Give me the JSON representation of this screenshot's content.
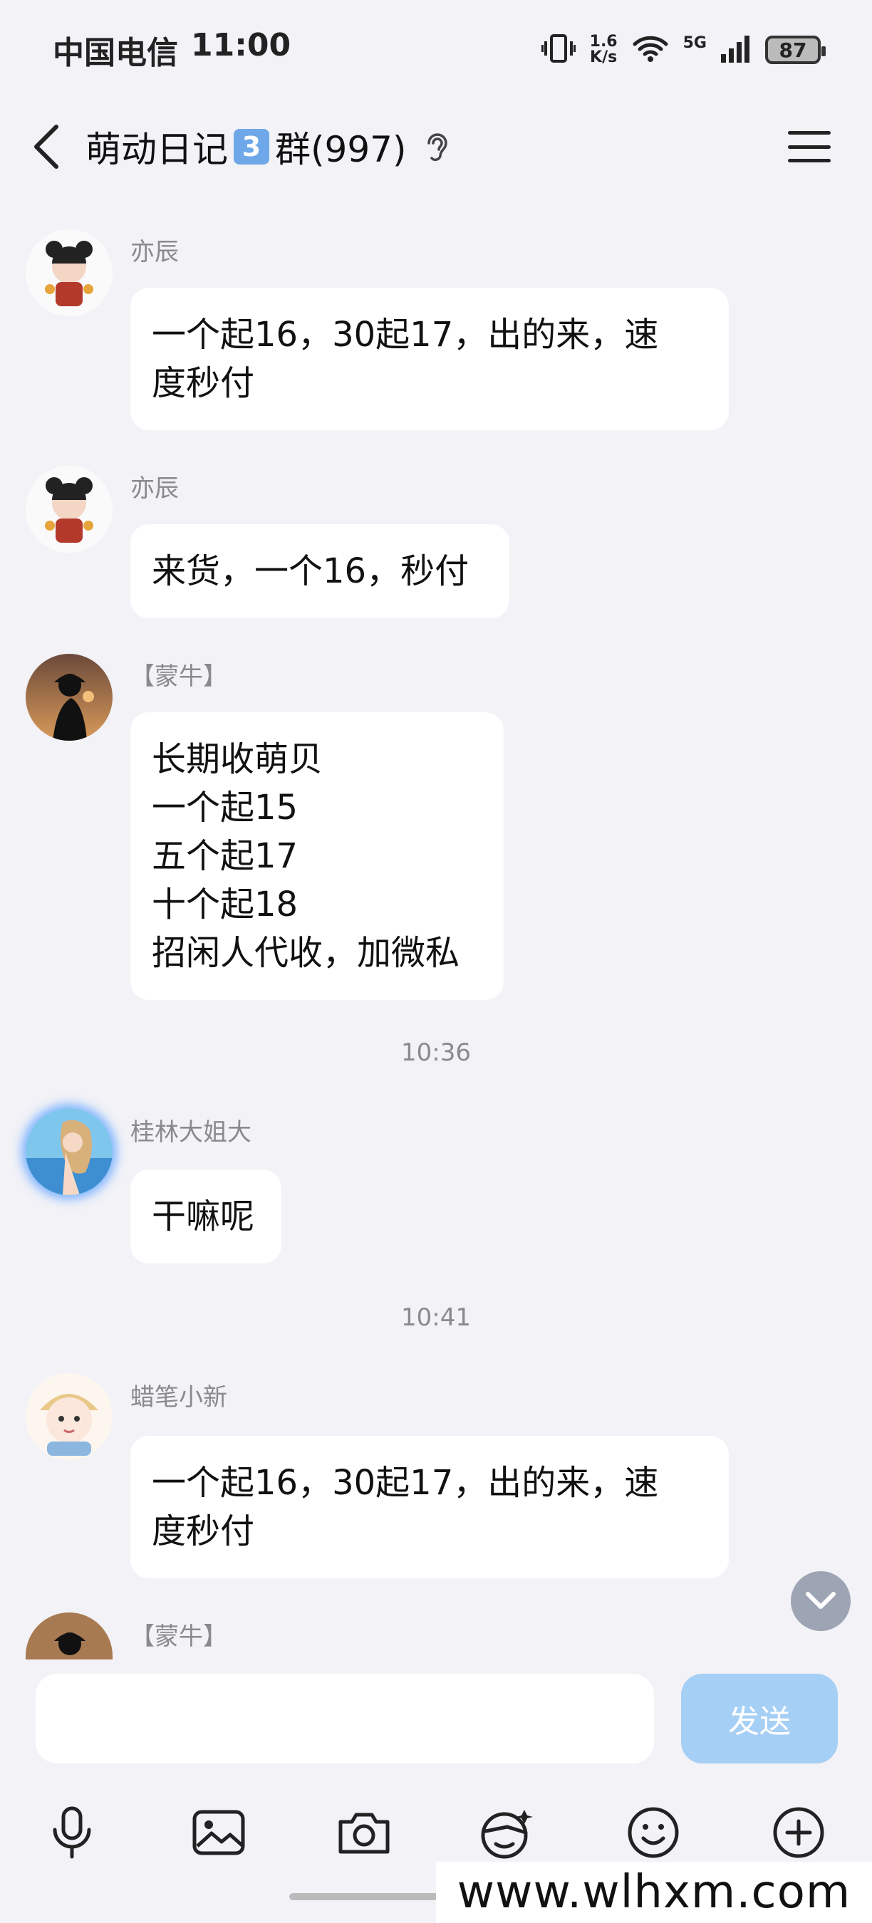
{
  "status_bar": {
    "carrier": "中国电信",
    "time": "11:00",
    "speed_value": "1.6",
    "speed_unit": "K/s",
    "network": "5G",
    "battery": "87"
  },
  "header": {
    "title_prefix": "萌动日记",
    "title_number": "3",
    "title_suffix": "群(997)"
  },
  "messages": [
    {
      "sender": "亦辰",
      "text": "一个起16，30起17，出的来，速\n度秒付"
    },
    {
      "sender": "亦辰",
      "text": "来货，一个16，秒付"
    },
    {
      "sender": "【蒙牛】",
      "text": "长期收萌贝\n一个起15\n五个起17\n十个起18\n招闲人代收，加微私"
    },
    {
      "time": "10:36"
    },
    {
      "sender": "桂林大姐大",
      "text": "干嘛呢"
    },
    {
      "time": "10:41"
    },
    {
      "sender": "蜡笔小新",
      "text": "一个起16，30起17，出的来，速\n度秒付"
    },
    {
      "sender": "【蒙牛】"
    }
  ],
  "input": {
    "placeholder": "",
    "send_label": "发送"
  },
  "toolbar": {
    "icons": [
      "microphone-icon",
      "image-icon",
      "camera-icon",
      "sticker-mask-icon",
      "emoji-icon",
      "plus-icon"
    ]
  },
  "watermark": "www.wlhxm.com",
  "colors": {
    "background": "#f2f2f7",
    "bubble": "#ffffff",
    "send_button": "#a6cff5",
    "number_box": "#6fa8e8"
  }
}
